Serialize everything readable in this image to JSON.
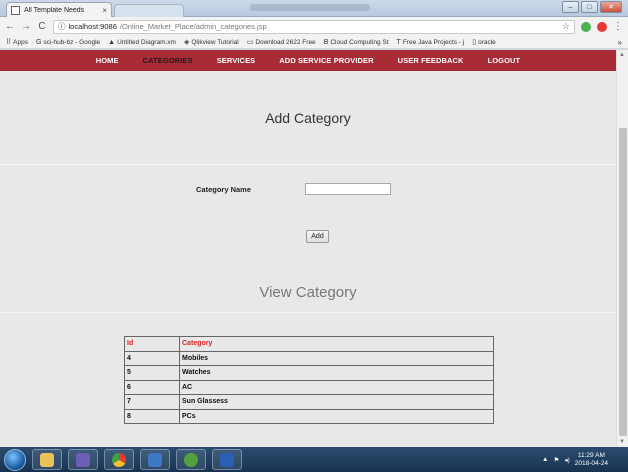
{
  "browser": {
    "tab_title": "All Template Needs",
    "tab_close": "×",
    "url_host": "localhost:9086",
    "url_path": "/Online_Market_Place/admin_categories.jsp",
    "back": "←",
    "forward": "→",
    "reload": "C",
    "info": "ⓘ",
    "star": "☆",
    "window_min": "–",
    "window_max": "□",
    "window_close": "✕",
    "menu": "⋮"
  },
  "bookmarks": [
    {
      "icon": "⠿",
      "label": "Apps"
    },
    {
      "icon": "G",
      "label": "sci-hub-bz - Google"
    },
    {
      "icon": "▲",
      "label": "Untitled Diagram.xm"
    },
    {
      "icon": "◈",
      "label": "Qlikview Tutorial"
    },
    {
      "icon": "▭",
      "label": "Download 2622 Free"
    },
    {
      "icon": "B",
      "label": "Cloud Computing St"
    },
    {
      "icon": "T",
      "label": "Free Java Projects - j"
    },
    {
      "icon": "▯",
      "label": "oracle"
    }
  ],
  "bookmarks_more": "»",
  "nav": [
    {
      "label": "HOME",
      "active": false
    },
    {
      "label": "CATEGORIES",
      "active": true
    },
    {
      "label": "SERVICES",
      "active": false
    },
    {
      "label": "ADD SERVICE PROVIDER",
      "active": false
    },
    {
      "label": "USER FEEDBACK",
      "active": false
    },
    {
      "label": "LOGOUT",
      "active": false
    }
  ],
  "add_section": {
    "heading": "Add Category",
    "field_label": "Category Name",
    "field_value": "",
    "button_label": "Add"
  },
  "view_section": {
    "heading": "View Category",
    "columns": [
      "Id",
      "Category"
    ],
    "rows": [
      {
        "id": "4",
        "name": "Mobiles"
      },
      {
        "id": "5",
        "name": "Watches"
      },
      {
        "id": "6",
        "name": "AC"
      },
      {
        "id": "7",
        "name": "Sun Glassess"
      },
      {
        "id": "8",
        "name": "PCs"
      }
    ]
  },
  "taskbar": {
    "time": "11:29 AM",
    "date": "2018-04-24"
  },
  "colors": {
    "nav_bg": "#a92b35",
    "header_text": "#e01e1e"
  }
}
